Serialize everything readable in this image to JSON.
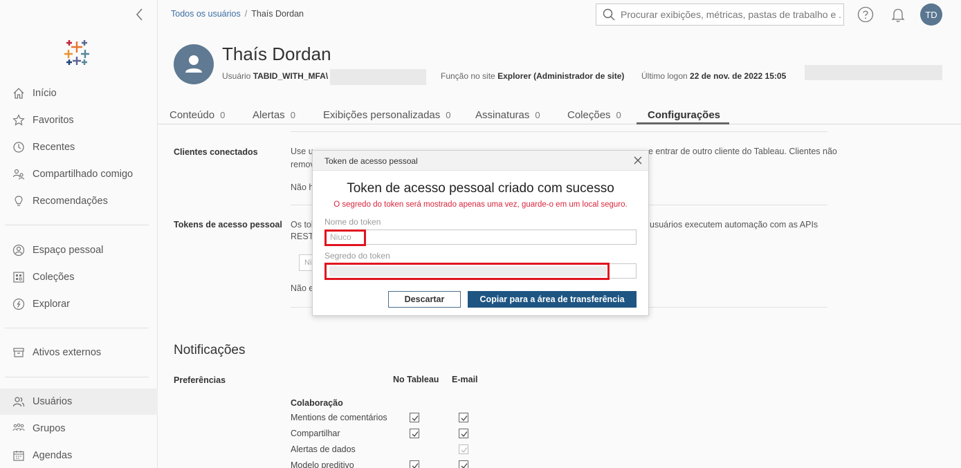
{
  "sidebar": {
    "items": [
      {
        "label": "Início",
        "icon": "home-icon"
      },
      {
        "label": "Favoritos",
        "icon": "star-icon"
      },
      {
        "label": "Recentes",
        "icon": "clock-icon"
      },
      {
        "label": "Compartilhado comigo",
        "icon": "shared-icon"
      },
      {
        "label": "Recomendações",
        "icon": "lightbulb-icon"
      },
      {
        "label": "Espaço pessoal",
        "icon": "person-circle-icon"
      },
      {
        "label": "Coleções",
        "icon": "collections-icon"
      },
      {
        "label": "Explorar",
        "icon": "compass-icon"
      },
      {
        "label": "Ativos externos",
        "icon": "archive-icon"
      },
      {
        "label": "Usuários",
        "icon": "users-icon"
      },
      {
        "label": "Grupos",
        "icon": "groups-icon"
      },
      {
        "label": "Agendas",
        "icon": "calendar-icon"
      }
    ],
    "active": "Usuários"
  },
  "header": {
    "breadcrumb_link": "Todos os usuários",
    "breadcrumb_sep": "/",
    "breadcrumb_current": "Thaís Dordan",
    "search_placeholder": "Procurar exibições, métricas, pastas de trabalho e ...",
    "avatar_initials": "TD"
  },
  "profile": {
    "name": "Thaís Dordan",
    "user_label": "Usuário",
    "user_value": "TABID_WITH_MFA\\",
    "role_label": "Função no site",
    "role_value": "Explorer (Administrador de site)",
    "logon_label": "Último logon",
    "logon_value": "22 de nov. de 2022 15:05"
  },
  "tabs": [
    {
      "label": "Conteúdo",
      "count": "0"
    },
    {
      "label": "Alertas",
      "count": "0"
    },
    {
      "label": "Exibições personalizadas",
      "count": "0"
    },
    {
      "label": "Assinaturas",
      "count": "0"
    },
    {
      "label": "Coleções",
      "count": "0"
    },
    {
      "label": "Configurações",
      "count": ""
    }
  ],
  "settings": {
    "connected_clients_label": "Clientes conectados",
    "connected_clients_text_1a": "Use u",
    "connected_clients_text_1b": "e entrar de outro cliente do Tableau. Clientes não",
    "connected_clients_text_2": "remov",
    "connected_clients_text_3": "Não h",
    "tokens_label": "Tokens de acesso pessoal",
    "tokens_text_1a": "Os tol",
    "tokens_text_1b": "usuários executem automação com as APIs",
    "tokens_text_2": "REST",
    "tokens_input_fragment": "Ni",
    "tokens_text_3": "Não e"
  },
  "notifications": {
    "title": "Notificações",
    "preferences_label": "Preferências",
    "col_tableau": "No Tableau",
    "col_email": "E-mail",
    "group_label": "Colaboração",
    "rows": [
      {
        "label": "Mentions de comentários",
        "tableau": true,
        "email": true
      },
      {
        "label": "Compartilhar",
        "tableau": true,
        "email": true
      },
      {
        "label": "Alertas de dados",
        "tableau": null,
        "email": true
      },
      {
        "label": "Modelo preditivo",
        "tableau": true,
        "email": true
      }
    ]
  },
  "modal": {
    "header": "Token de acesso pessoal",
    "title": "Token de acesso pessoal criado com sucesso",
    "warning": "O segredo do token será mostrado apenas uma vez, guarde-o em um local seguro.",
    "name_label": "Nome do token",
    "name_value": "Niuco",
    "secret_label": "Segredo do token",
    "discard_label": "Descartar",
    "copy_label": "Copiar para a área de transferência"
  },
  "colors": {
    "primary": "#1f5582",
    "highlight": "#e0141f",
    "warning": "#d7253c",
    "link": "#3c6fa5"
  }
}
